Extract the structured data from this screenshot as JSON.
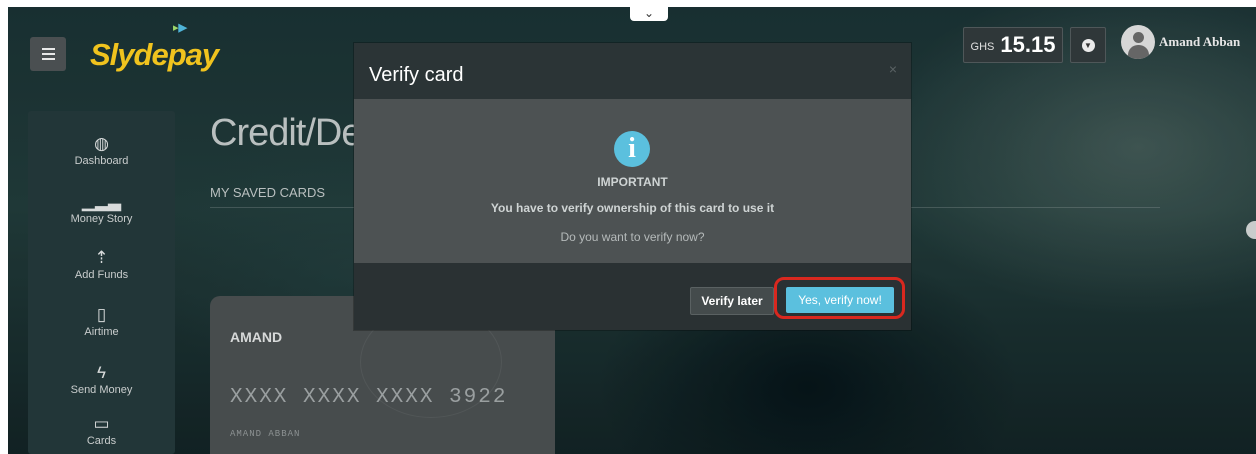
{
  "header": {
    "logo_text": "Slydepay",
    "collapse_glyph": "⌄",
    "balance": {
      "currency": "GHS",
      "amount": "15.15"
    },
    "user_name": "Amand Abban"
  },
  "sidebar": {
    "items": [
      {
        "label": "Dashboard",
        "icon": "dashboard-icon"
      },
      {
        "label": "Money Story",
        "icon": "signal-bars-icon"
      },
      {
        "label": "Add Funds",
        "icon": "upload-arrow-icon"
      },
      {
        "label": "Airtime",
        "icon": "mobile-phone-icon"
      },
      {
        "label": "Send Money",
        "icon": "lightning-icon"
      },
      {
        "label": "Cards",
        "icon": "credit-card-icon"
      }
    ]
  },
  "main": {
    "title": "Credit/Deb",
    "section_label": "MY SAVED CARDS",
    "card": {
      "holder": "AMAND",
      "number": "XXXX XXXX XXXX 3922",
      "name": "AMAND ABBAN"
    }
  },
  "modal": {
    "title": "Verify card",
    "close_glyph": "×",
    "icon": "info-icon",
    "important": "IMPORTANT",
    "message": "You have to verify ownership of this card to use it",
    "question": "Do you want to verify now?",
    "later_label": "Verify later",
    "verify_label": "Yes, verify now!"
  },
  "colors": {
    "accent": "#5bc0de",
    "logo": "#f0c31e",
    "highlight": "#d9281f"
  }
}
